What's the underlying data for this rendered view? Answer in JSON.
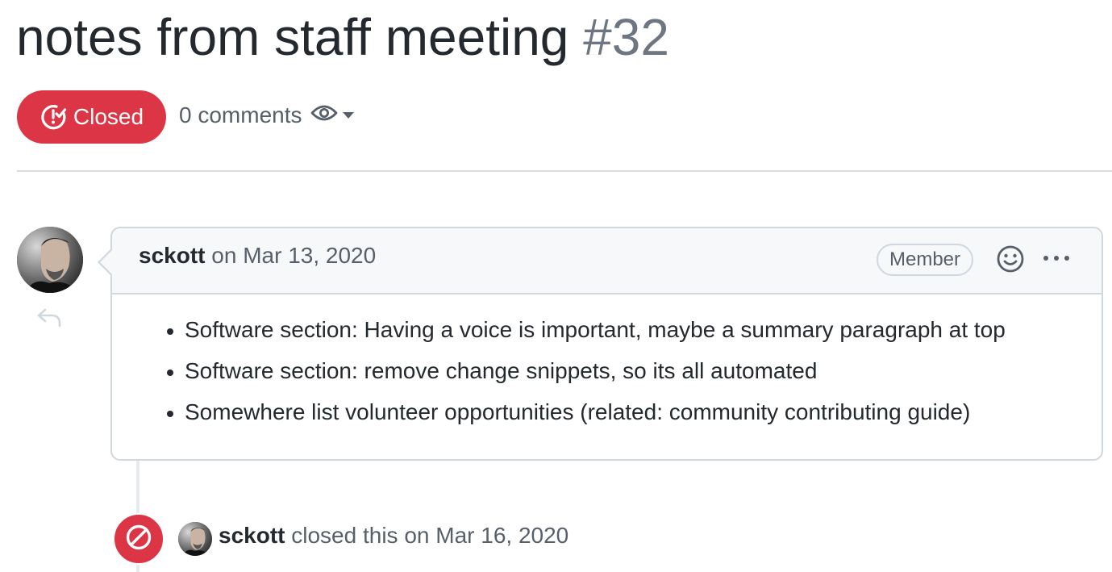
{
  "issue": {
    "title": "notes from staff meeting",
    "number": "#32",
    "state": "Closed",
    "comments_count": "0 comments"
  },
  "comment": {
    "author": "sckott",
    "date_prefix": "on",
    "date": "Mar 13, 2020",
    "role": "Member",
    "body_items": [
      "Software section: Having a voice is important, maybe a summary paragraph at top",
      "Software section: remove change snippets, so its all automated",
      "Somewhere list volunteer opportunities (related: community contributing guide)"
    ]
  },
  "timeline_event": {
    "actor": "sckott",
    "action": "closed this",
    "date_prefix": "on",
    "date": "Mar 16, 2020"
  },
  "icons": {
    "state": "issue-closed-icon",
    "watch": "eye-icon",
    "reply": "reply-icon",
    "reaction": "smiley-icon",
    "more": "kebab-horizontal-icon",
    "closed_event": "circle-slash-icon"
  },
  "colors": {
    "closed_red": "#dc3545",
    "text_primary": "#24292f",
    "text_muted": "#57606a",
    "border": "#d0d7de",
    "header_bg": "#f6f8fa"
  }
}
